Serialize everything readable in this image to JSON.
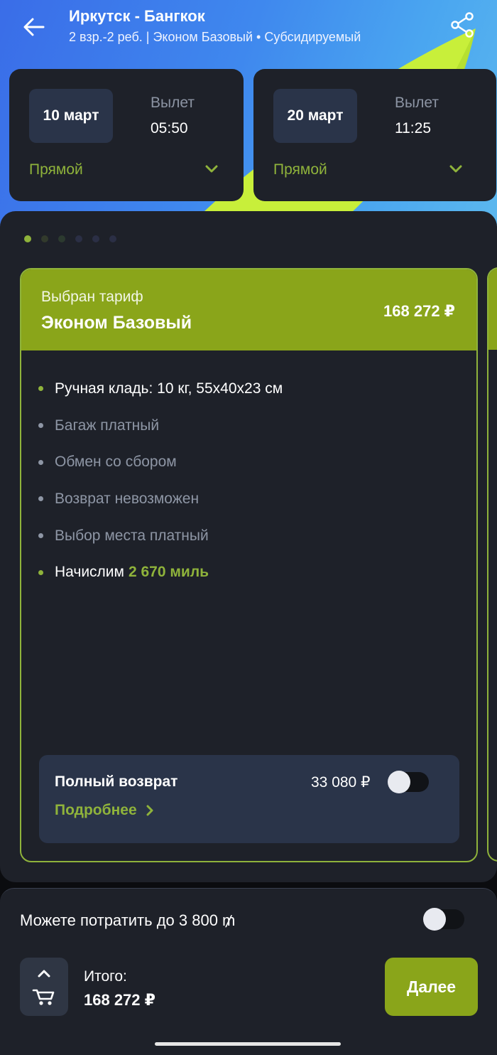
{
  "header": {
    "title": "Иркутск - Бангкок",
    "subtitle": "2 взр.-2 реб. | Эконом Базовый • Субсидируемый",
    "back_icon": "arrow-left-icon",
    "share_icon": "share-icon"
  },
  "flights": [
    {
      "date": "10 март",
      "departure_label": "Вылет",
      "departure_time": "05:50",
      "type": "Прямой"
    },
    {
      "date": "20 март",
      "departure_label": "Вылет",
      "departure_time": "11:25",
      "type": "Прямой"
    }
  ],
  "pager": {
    "count": 6,
    "active_index": 0
  },
  "tariff": {
    "chosen_label": "Выбран тариф",
    "name": "Эконом Базовый",
    "price": "168 272 ₽",
    "features": [
      {
        "text": "Ручная кладь: 10 кг, 55х40х23 см",
        "included": true
      },
      {
        "text": "Багаж платный",
        "included": false
      },
      {
        "text": "Обмен со сбором",
        "included": false
      },
      {
        "text": "Возврат невозможен",
        "included": false
      },
      {
        "text": "Выбор места платный",
        "included": false
      },
      {
        "text": "Начислим",
        "highlight": "2 670 миль",
        "included": true
      }
    ],
    "refund": {
      "title": "Полный возврат",
      "price": "33 080 ₽",
      "more": "Подробнее",
      "enabled": false
    }
  },
  "bottom": {
    "miles_text": "Можете потратить до 3 800 ₥",
    "miles_enabled": false,
    "total_label": "Итого:",
    "total_value": "168 272 ₽",
    "next_label": "Далее",
    "cart_icon": "cart-icon"
  },
  "colors": {
    "accent": "#8aa51a",
    "accent_text": "#8fb33b",
    "card_bg": "#1e2129",
    "chip_bg": "#2a3449"
  }
}
